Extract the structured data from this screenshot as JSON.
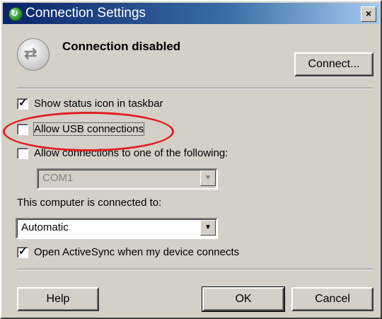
{
  "window": {
    "title": "Connection Settings",
    "close_label": "×"
  },
  "status": {
    "text": "Connection disabled",
    "connect_button": "Connect..."
  },
  "options": {
    "show_status_icon": {
      "label": "Show status icon in taskbar",
      "checked": true
    },
    "allow_usb": {
      "label": "Allow USB connections",
      "checked": false
    },
    "allow_connections": {
      "label": "Allow connections to one of the following:",
      "checked": false
    },
    "port_select": {
      "value": "COM1"
    }
  },
  "connected_to": {
    "label": "This computer is connected to:",
    "value": "Automatic"
  },
  "open_activesync": {
    "label": "Open ActiveSync when my device connects",
    "checked": true
  },
  "buttons": {
    "help": "Help",
    "ok": "OK",
    "cancel": "Cancel"
  },
  "colors": {
    "highlight": "#e02020",
    "titlebar": "#0a246a"
  },
  "icons": {
    "title": "activesync-icon",
    "status": "sync-arrows-icon"
  }
}
